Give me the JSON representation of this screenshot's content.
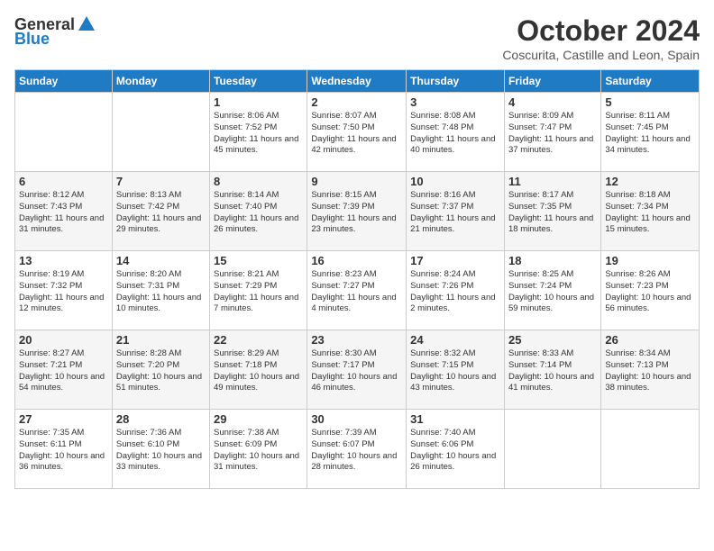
{
  "header": {
    "logo_general": "General",
    "logo_blue": "Blue",
    "title": "October 2024",
    "subtitle": "Coscurita, Castille and Leon, Spain"
  },
  "weekdays": [
    "Sunday",
    "Monday",
    "Tuesday",
    "Wednesday",
    "Thursday",
    "Friday",
    "Saturday"
  ],
  "weeks": [
    [
      {
        "day": "",
        "info": ""
      },
      {
        "day": "",
        "info": ""
      },
      {
        "day": "1",
        "info": "Sunrise: 8:06 AM\nSunset: 7:52 PM\nDaylight: 11 hours and 45 minutes."
      },
      {
        "day": "2",
        "info": "Sunrise: 8:07 AM\nSunset: 7:50 PM\nDaylight: 11 hours and 42 minutes."
      },
      {
        "day": "3",
        "info": "Sunrise: 8:08 AM\nSunset: 7:48 PM\nDaylight: 11 hours and 40 minutes."
      },
      {
        "day": "4",
        "info": "Sunrise: 8:09 AM\nSunset: 7:47 PM\nDaylight: 11 hours and 37 minutes."
      },
      {
        "day": "5",
        "info": "Sunrise: 8:11 AM\nSunset: 7:45 PM\nDaylight: 11 hours and 34 minutes."
      }
    ],
    [
      {
        "day": "6",
        "info": "Sunrise: 8:12 AM\nSunset: 7:43 PM\nDaylight: 11 hours and 31 minutes."
      },
      {
        "day": "7",
        "info": "Sunrise: 8:13 AM\nSunset: 7:42 PM\nDaylight: 11 hours and 29 minutes."
      },
      {
        "day": "8",
        "info": "Sunrise: 8:14 AM\nSunset: 7:40 PM\nDaylight: 11 hours and 26 minutes."
      },
      {
        "day": "9",
        "info": "Sunrise: 8:15 AM\nSunset: 7:39 PM\nDaylight: 11 hours and 23 minutes."
      },
      {
        "day": "10",
        "info": "Sunrise: 8:16 AM\nSunset: 7:37 PM\nDaylight: 11 hours and 21 minutes."
      },
      {
        "day": "11",
        "info": "Sunrise: 8:17 AM\nSunset: 7:35 PM\nDaylight: 11 hours and 18 minutes."
      },
      {
        "day": "12",
        "info": "Sunrise: 8:18 AM\nSunset: 7:34 PM\nDaylight: 11 hours and 15 minutes."
      }
    ],
    [
      {
        "day": "13",
        "info": "Sunrise: 8:19 AM\nSunset: 7:32 PM\nDaylight: 11 hours and 12 minutes."
      },
      {
        "day": "14",
        "info": "Sunrise: 8:20 AM\nSunset: 7:31 PM\nDaylight: 11 hours and 10 minutes."
      },
      {
        "day": "15",
        "info": "Sunrise: 8:21 AM\nSunset: 7:29 PM\nDaylight: 11 hours and 7 minutes."
      },
      {
        "day": "16",
        "info": "Sunrise: 8:23 AM\nSunset: 7:27 PM\nDaylight: 11 hours and 4 minutes."
      },
      {
        "day": "17",
        "info": "Sunrise: 8:24 AM\nSunset: 7:26 PM\nDaylight: 11 hours and 2 minutes."
      },
      {
        "day": "18",
        "info": "Sunrise: 8:25 AM\nSunset: 7:24 PM\nDaylight: 10 hours and 59 minutes."
      },
      {
        "day": "19",
        "info": "Sunrise: 8:26 AM\nSunset: 7:23 PM\nDaylight: 10 hours and 56 minutes."
      }
    ],
    [
      {
        "day": "20",
        "info": "Sunrise: 8:27 AM\nSunset: 7:21 PM\nDaylight: 10 hours and 54 minutes."
      },
      {
        "day": "21",
        "info": "Sunrise: 8:28 AM\nSunset: 7:20 PM\nDaylight: 10 hours and 51 minutes."
      },
      {
        "day": "22",
        "info": "Sunrise: 8:29 AM\nSunset: 7:18 PM\nDaylight: 10 hours and 49 minutes."
      },
      {
        "day": "23",
        "info": "Sunrise: 8:30 AM\nSunset: 7:17 PM\nDaylight: 10 hours and 46 minutes."
      },
      {
        "day": "24",
        "info": "Sunrise: 8:32 AM\nSunset: 7:15 PM\nDaylight: 10 hours and 43 minutes."
      },
      {
        "day": "25",
        "info": "Sunrise: 8:33 AM\nSunset: 7:14 PM\nDaylight: 10 hours and 41 minutes."
      },
      {
        "day": "26",
        "info": "Sunrise: 8:34 AM\nSunset: 7:13 PM\nDaylight: 10 hours and 38 minutes."
      }
    ],
    [
      {
        "day": "27",
        "info": "Sunrise: 7:35 AM\nSunset: 6:11 PM\nDaylight: 10 hours and 36 minutes."
      },
      {
        "day": "28",
        "info": "Sunrise: 7:36 AM\nSunset: 6:10 PM\nDaylight: 10 hours and 33 minutes."
      },
      {
        "day": "29",
        "info": "Sunrise: 7:38 AM\nSunset: 6:09 PM\nDaylight: 10 hours and 31 minutes."
      },
      {
        "day": "30",
        "info": "Sunrise: 7:39 AM\nSunset: 6:07 PM\nDaylight: 10 hours and 28 minutes."
      },
      {
        "day": "31",
        "info": "Sunrise: 7:40 AM\nSunset: 6:06 PM\nDaylight: 10 hours and 26 minutes."
      },
      {
        "day": "",
        "info": ""
      },
      {
        "day": "",
        "info": ""
      }
    ]
  ]
}
